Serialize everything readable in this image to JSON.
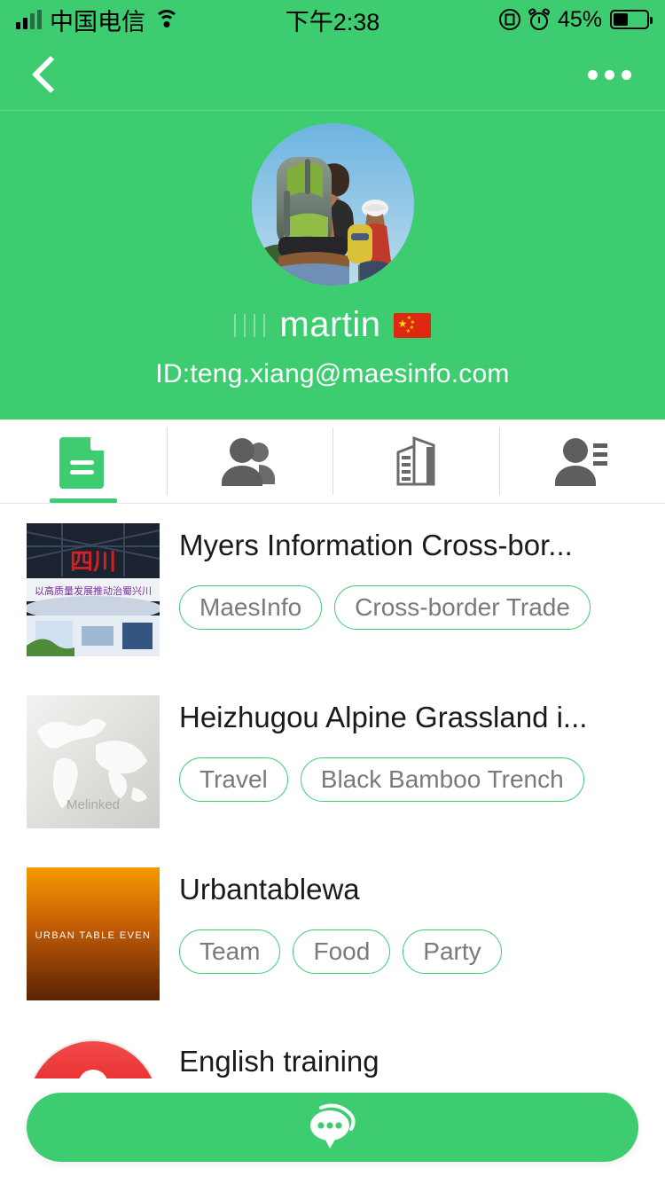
{
  "status_bar": {
    "carrier": "中国电信",
    "time": "下午2:38",
    "battery_percent": "45%",
    "battery_level": 45,
    "icons": [
      "signal-bars",
      "wifi-icon",
      "rotation-lock-icon",
      "alarm-clock-icon",
      "battery-icon"
    ]
  },
  "nav": {
    "back_icon": "chevron-left-icon",
    "more_icon": "more-horizontal-icon"
  },
  "profile": {
    "avatar_alt": "hikers-with-backpacks-photo",
    "name_prefix": "||||",
    "username": "martin",
    "flag": "china-flag",
    "user_id": "ID:teng.xiang@maesinfo.com"
  },
  "tabs": [
    {
      "id": "tab-documents",
      "icon": "document-icon",
      "active": true
    },
    {
      "id": "tab-groups",
      "icon": "people-group-icon",
      "active": false
    },
    {
      "id": "tab-company",
      "icon": "building-icon",
      "active": false
    },
    {
      "id": "tab-contacts",
      "icon": "person-list-icon",
      "active": false
    }
  ],
  "list": [
    {
      "title": "Myers Information Cross-bor...",
      "thumb": "exhibition-booth-photo",
      "tags": [
        "MaesInfo",
        "Cross-border Trade"
      ]
    },
    {
      "title": "Heizhugou Alpine Grassland i...",
      "thumb": "world-map-placeholder",
      "thumb_watermark": "Melinked",
      "tags": [
        "Travel",
        "Black Bamboo Trench"
      ]
    },
    {
      "title": "Urbantablewa",
      "thumb": "orange-gradient-poster",
      "thumb_caption": "URBAN TABLE EVEN",
      "tags": [
        "Team",
        "Food",
        "Party"
      ]
    },
    {
      "title": "English training",
      "thumb": "red-microphone-icon",
      "tags": []
    }
  ],
  "fab": {
    "icon": "chat-bubble-icon"
  },
  "colors": {
    "brand_green": "#3ECC71",
    "tag_border": "#3ECC71",
    "tag_text": "#7a7a7a",
    "title_text": "#1a1a1a",
    "tab_icon_inactive": "#6b6b6b"
  }
}
